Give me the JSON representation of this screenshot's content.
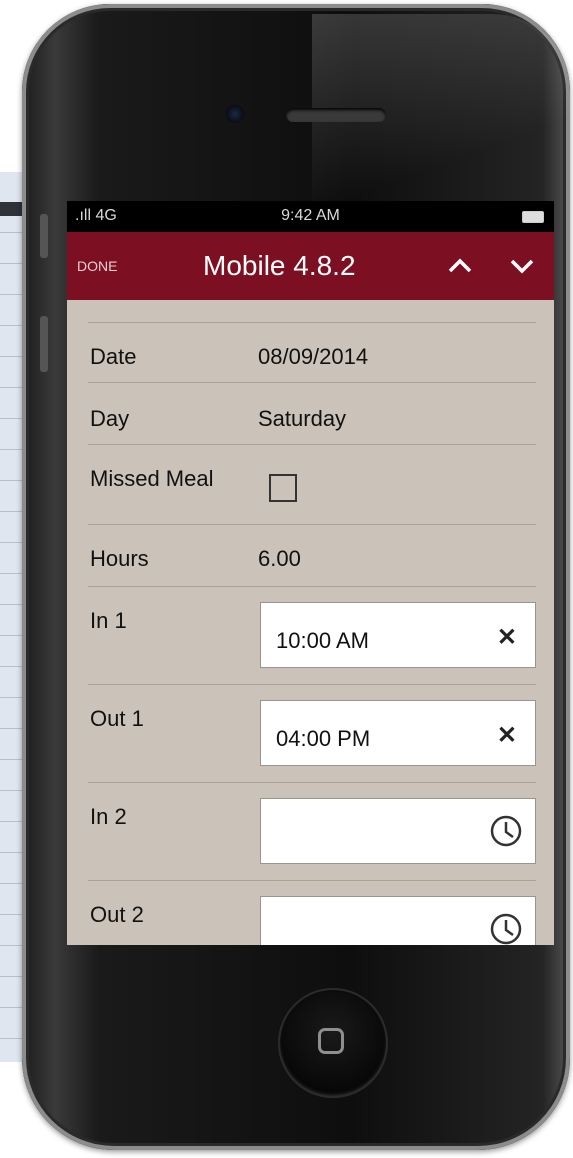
{
  "status_bar": {
    "signal": ".ıll 4G",
    "time": "9:42 AM"
  },
  "nav_bar": {
    "done_label": "DONE",
    "title": "Mobile 4.8.2"
  },
  "form": {
    "date_label": "Date",
    "date_value": "08/09/2014",
    "day_label": "Day",
    "day_value": "Saturday",
    "missed_meal_label": "Missed Meal",
    "missed_meal_checked": false,
    "hours_label": "Hours",
    "hours_value": "6.00",
    "in1_label": "In 1",
    "in1_value": "10:00 AM",
    "out1_label": "Out 1",
    "out1_value": "04:00 PM",
    "in2_label": "In 2",
    "in2_value": "",
    "out2_label": "Out 2",
    "out2_value": ""
  },
  "icons": {
    "clear": "close-icon",
    "time": "clock-icon",
    "prev": "chevron-up-icon",
    "next": "chevron-down-icon"
  },
  "colors": {
    "nav_bar": "#7c0f22",
    "screen_bg": "#cbc3b9"
  }
}
